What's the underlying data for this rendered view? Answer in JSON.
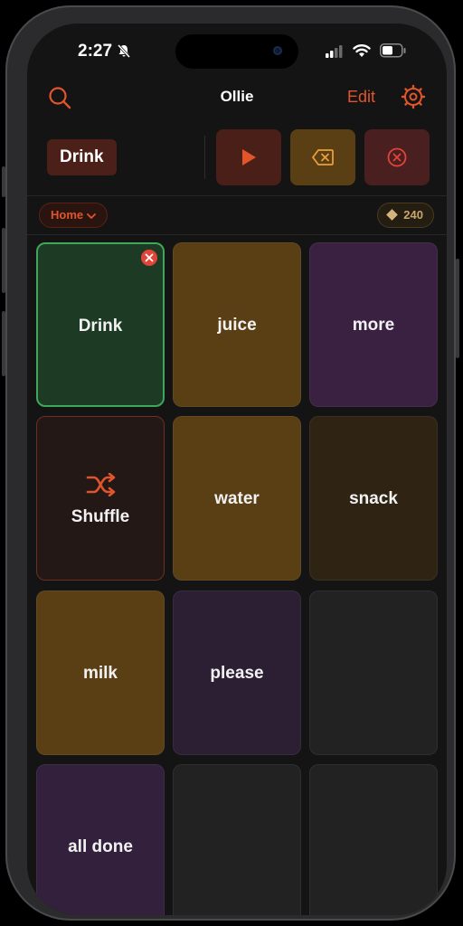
{
  "status_bar": {
    "time": "2:27"
  },
  "nav": {
    "title": "Ollie",
    "edit_label": "Edit"
  },
  "speech_bar": {
    "current_word": "Drink"
  },
  "context_bar": {
    "folder": "Home",
    "points": "240"
  },
  "colors": {
    "accent": "#e2552a",
    "tile_green": "#1c3a24",
    "tile_amber": "#5a3f15",
    "tile_purple": "#3a2142",
    "tile_dark_brown": "#2f2414",
    "tile_empty": "#222222"
  },
  "grid": {
    "tiles": [
      {
        "label": "Drink",
        "color": "tile_green",
        "selected": true
      },
      {
        "label": "juice",
        "color": "tile_amber"
      },
      {
        "label": "more",
        "color": "tile_purple"
      },
      {
        "label": "Shuffle",
        "icon": "shuffle-icon"
      },
      {
        "label": "water",
        "color": "tile_amber"
      },
      {
        "label": "snack",
        "color": "tile_dark_brown"
      },
      {
        "label": "milk",
        "color": "tile_amber"
      },
      {
        "label": "please",
        "color": "tile_purple"
      },
      {
        "label": "",
        "color": "tile_empty"
      },
      {
        "label": "all done",
        "color": "tile_purple"
      },
      {
        "label": "",
        "color": "tile_empty"
      },
      {
        "label": "",
        "color": "tile_empty"
      }
    ]
  }
}
